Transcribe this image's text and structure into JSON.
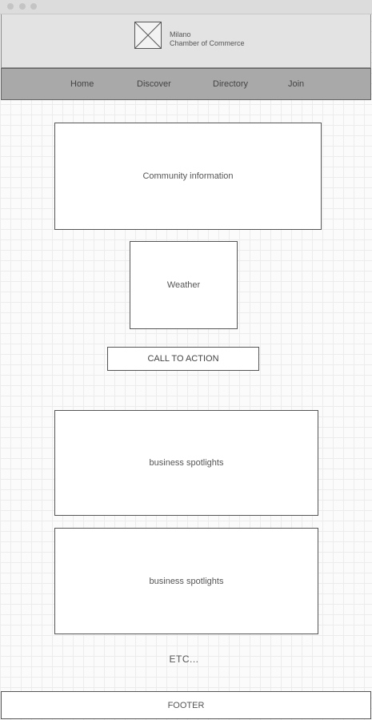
{
  "window": {
    "controls": [
      "close",
      "minimize",
      "maximize"
    ]
  },
  "header": {
    "logo_icon": "image-placeholder-icon",
    "brand_line1": "Milano",
    "brand_line2": "Chamber of Commerce"
  },
  "nav": {
    "items": [
      {
        "label": "Home"
      },
      {
        "label": "Discover"
      },
      {
        "label": "Directory"
      },
      {
        "label": "Join"
      }
    ]
  },
  "main": {
    "community": "Community information",
    "weather": "Weather",
    "cta": "CALL TO ACTION",
    "spotlights": [
      {
        "label": "business spotlights"
      },
      {
        "label": "business spotlights"
      }
    ],
    "etc": "ETC..."
  },
  "footer": {
    "label": "FOOTER"
  }
}
